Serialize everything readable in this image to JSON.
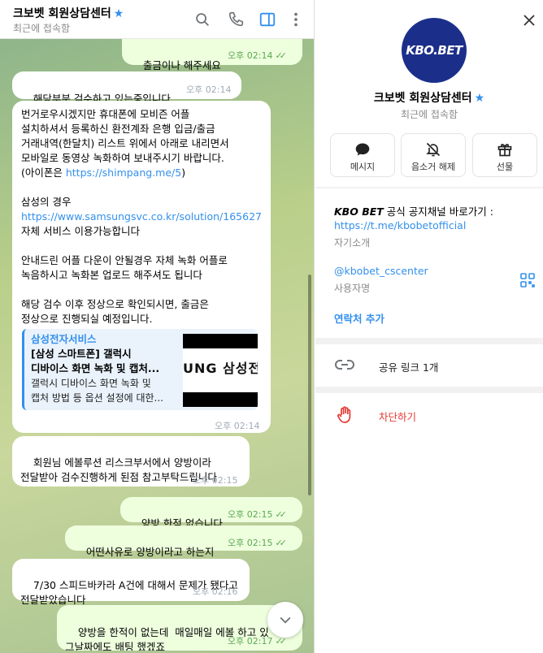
{
  "chat": {
    "title": "크보벳 회원상담센터",
    "status": "최근에 접속함",
    "messages": [
      {
        "dir": "out",
        "text": "출금이나 해주세요",
        "time": "오후 02:14"
      },
      {
        "dir": "in",
        "text": "해당부분 검수하고 있는중입니다.",
        "time": "오후 02:14"
      },
      {
        "dir": "in",
        "p1": "번거로우시겠지만 휴대폰에 모비즌 어플\n설치하셔서 등록하신 환전계좌 은행 입금/출금\n거래내역(한달치) 리스트 위에서 아래로 내리면서\n모바일로 동영상 녹화하여 보내주시기 바랍니다.\n(아이폰은 ",
        "link1": "https://shimpang.me/5",
        "p2": ")\n\n삼성의 경우\n",
        "link2": "https://www.samsungsvc.co.kr/solution/165627",
        "p3": "\n자체 서비스 이용가능합니다\n\n안내드린 어플 다운이 안될경우 자체 녹화 어플로\n녹음하시고 녹화본 업로드 해주셔도 됩니다\n\n해당 검수 이후 정상으로 확인되시면, 출금은\n정상으로 진행되실 예정입니다.",
        "preview": {
          "site": "삼성전자서비스",
          "title": "[삼성 스마트폰] 갤럭시\n디바이스 화면 녹화 및 캡처...",
          "desc": "갤럭시 디바이스 화면 녹화 및\n캡처 방법 등 옵션 설정에 대한...",
          "thumb_text": "UNG 삼성전"
        },
        "time": "오후 02:14"
      },
      {
        "dir": "in",
        "text": "회원님 에볼루션 리스크부서에서 양방이라\n전달받아 검수진행하게 된점 참고부탁드립니다",
        "time": "오후 02:15"
      },
      {
        "dir": "out",
        "text": "양방 한적 없습니다",
        "time": "오후 02:15"
      },
      {
        "dir": "out",
        "text": "어떤사유로 양방이라고 하는지",
        "time": "오후 02:15"
      },
      {
        "dir": "in",
        "text": "7/30 스피드바카라 A건에 대해서 문제가 됐다고\n전달받았습니다",
        "time": "오후 02:16"
      },
      {
        "dir": "out",
        "text": "양방을 한적이 없는데  매일매일 에볼 하고 있\n그날짜에도 배팅 했겠죠",
        "time": "오후 02:17"
      }
    ]
  },
  "profile": {
    "avatar_text": "KBO.BET",
    "name": "크보벳 회원상담센터",
    "status": "최근에 접속함",
    "actions": [
      {
        "label": "메시지",
        "icon": "chat-bubble-icon"
      },
      {
        "label": "음소거 해제",
        "icon": "bell-off-icon"
      },
      {
        "label": "선물",
        "icon": "gift-icon"
      }
    ],
    "info_brand": "KBO BET",
    "info_text": " 공식 공지채널 바로가기 :",
    "info_link": "https://t.me/kbobetofficial",
    "info_caption": "자기소개",
    "username": "@kbobet_cscenter",
    "username_caption": "사용자명",
    "add_contact": "연락처 추가",
    "shared_links": "공유 링크 1개",
    "block": "차단하기"
  },
  "colors": {
    "accent": "#3390ec",
    "outgoing_bubble": "#eeffde",
    "danger": "#e53935"
  }
}
